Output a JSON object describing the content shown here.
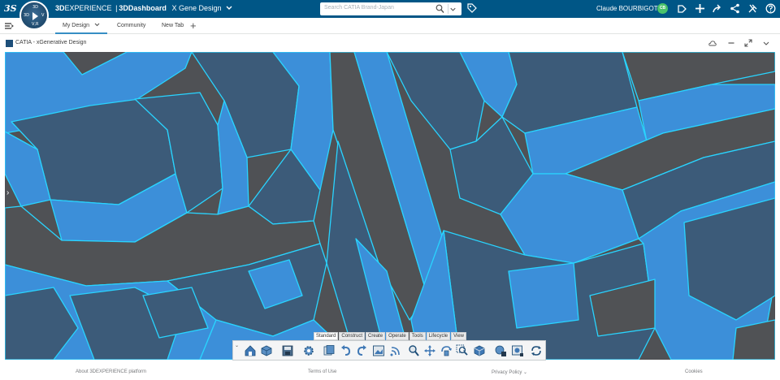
{
  "topbar": {
    "brand_prefix": "3D",
    "brand_experience": "EXPERIENCE",
    "brand_separator": "|",
    "brand_dashboard_prefix": "3D",
    "brand_dashboard": "Dashboard",
    "dashboard_name": "X Gene Design",
    "search_placeholder": "Search CATIA Brand-Japan",
    "user_name": "Claude BOURBIGOT",
    "avatar_initials": "CB",
    "compass_labels": {
      "top": "3D",
      "left": "3D",
      "right": "V",
      "bottom": "V,R"
    },
    "colors": {
      "bar": "#005686",
      "avatar": "#4ac36b"
    },
    "icons": [
      "tag-icon",
      "share-icon",
      "plus-icon",
      "forward-icon",
      "network-icon",
      "tools-icon",
      "help-icon"
    ]
  },
  "tabs": {
    "items": [
      {
        "label": "My Design",
        "active": true
      },
      {
        "label": "Community",
        "active": false
      },
      {
        "label": "New Tab",
        "active": false
      }
    ]
  },
  "widget": {
    "title": "CATIA - xGenerative Design",
    "controls": [
      "cloud-icon",
      "minimize-icon",
      "maximize-icon",
      "chevron-down-icon"
    ]
  },
  "viewer": {
    "colors": {
      "facade": "#3c8fd9",
      "roof": "#3c5b79",
      "road": "#505255",
      "edge": "#29d4ff"
    }
  },
  "actionbar": {
    "tabs": [
      {
        "label": "Standard",
        "active": true
      },
      {
        "label": "Construct",
        "active": false
      },
      {
        "label": "Create",
        "active": false
      },
      {
        "label": "Operate",
        "active": false
      },
      {
        "label": "Tools",
        "active": false
      },
      {
        "label": "Lifecycle",
        "active": false
      },
      {
        "label": "View",
        "active": false
      }
    ],
    "icons": [
      "home-icon",
      "open-icon",
      "save-icon",
      "settings-icon",
      "copy-icon",
      "undo-icon",
      "redo-icon",
      "image-icon",
      "broadcast-icon",
      "zoom-icon",
      "pan-icon",
      "rotate-icon",
      "zoom-area-icon",
      "cube-view-icon",
      "render-icon",
      "capture-icon",
      "sync-icon"
    ]
  },
  "footer": {
    "about": "About 3DEXPERIENCE platform",
    "terms": "Terms of Use",
    "privacy": "Privacy Policy",
    "cookies": "Cookies"
  }
}
